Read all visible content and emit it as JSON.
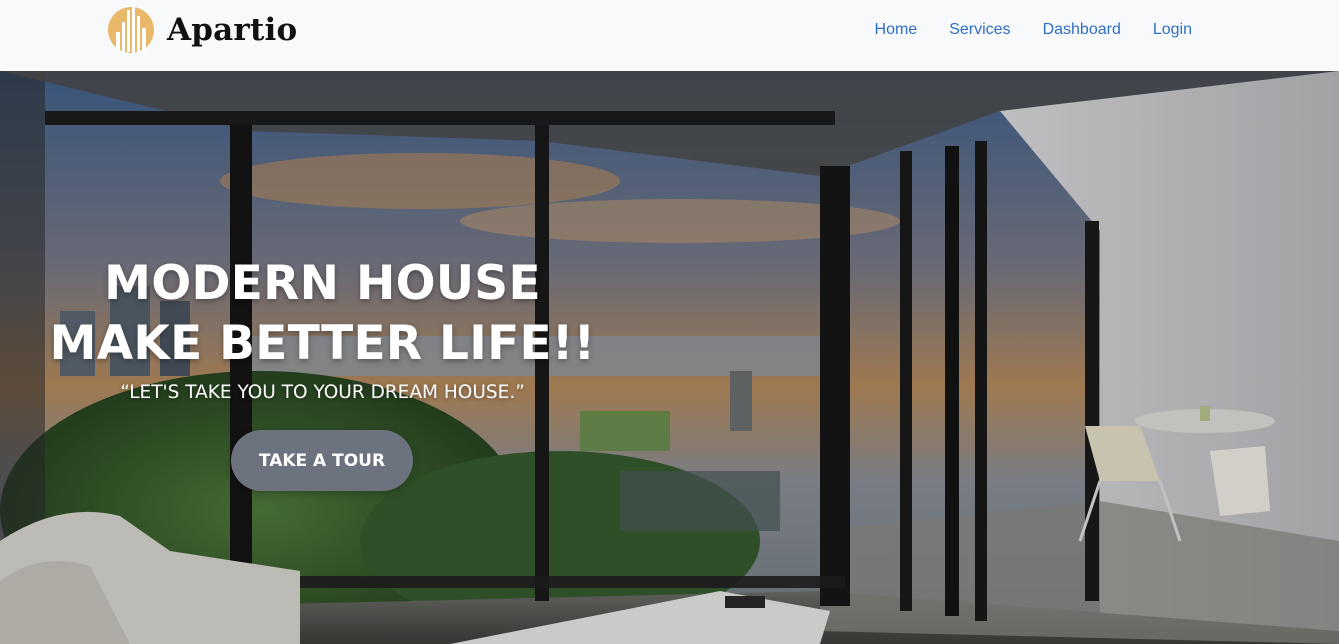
{
  "brand": {
    "name": "Apartio",
    "logo_icon": "building-logo-icon",
    "logo_color": "#e9b86a"
  },
  "nav": {
    "items": [
      {
        "label": "Home"
      },
      {
        "label": "Services"
      },
      {
        "label": "Dashboard"
      },
      {
        "label": "Login"
      }
    ],
    "link_color": "#2f6fc6"
  },
  "hero": {
    "title": "MODERN HOUSE MAKE BETTER LIFE!!",
    "subtitle": "“LET'S TAKE YOU TO YOUR DREAM HOUSE.”",
    "cta_label": "TAKE A TOUR",
    "cta_color": "#6c737e"
  }
}
